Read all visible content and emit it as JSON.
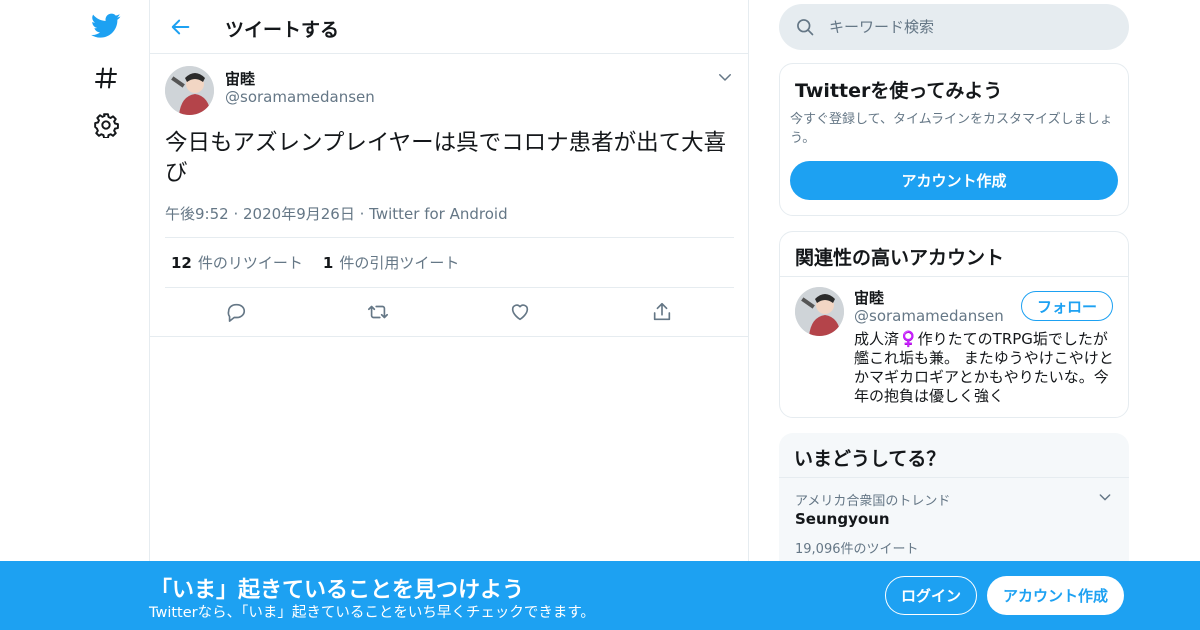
{
  "colors": {
    "accent": "#1da1f2",
    "text": "#14171a",
    "muted": "#657786",
    "border": "#e6ecf0"
  },
  "nav": {
    "items": [
      {
        "icon": "twitter-bird-icon"
      },
      {
        "icon": "hashtag-icon"
      },
      {
        "icon": "gear-icon"
      }
    ]
  },
  "header": {
    "title": "ツイートする",
    "back_icon": "arrow-left-icon"
  },
  "tweet": {
    "author_name": "宙睦",
    "author_handle": "@soramamedansen",
    "text": "今日もアズレンプレイヤーは呉でコロナ患者が出て大喜び",
    "time": "午後9:52",
    "date": "2020年9月26日",
    "source": "Twitter for Android",
    "retweet_count": "12",
    "retweet_label": "件のリツイート",
    "quote_count": "1",
    "quote_label": "件の引用ツイート"
  },
  "search": {
    "placeholder": "キーワード検索"
  },
  "signup_card": {
    "title": "Twitterを使ってみよう",
    "description": "今すぐ登録して、タイムラインをカスタマイズしましょう。",
    "button": "アカウント作成"
  },
  "related": {
    "title": "関連性の高いアカウント",
    "name": "宙睦",
    "handle": "@soramamedansen",
    "follow": "フォロー",
    "bio": "成人済♀️作りたてのTRPG垢でしたが艦これ垢も兼。 またゆうやけこやけとかマギカロギアとかもやりたいな。今年の抱負は優しく強く"
  },
  "trends": {
    "title": "いまどうしてる？",
    "context": "アメリカ合衆国のトレンド",
    "name": "Seungyoun",
    "count": "19,096件のツイート"
  },
  "banner": {
    "title": "「いま」起きていることを見つけよう",
    "subtitle": "Twitterなら、「いま」起きていることをいち早くチェックできます。",
    "login": "ログイン",
    "signup": "アカウント作成"
  }
}
